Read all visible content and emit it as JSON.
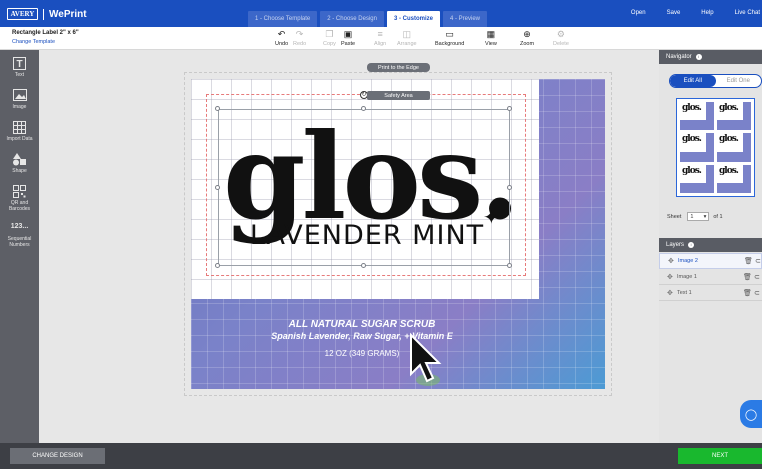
{
  "app": {
    "brand": "AVERY",
    "product": "WePrint"
  },
  "steps": [
    {
      "label": "1 - Choose Template"
    },
    {
      "label": "2 - Choose Design"
    },
    {
      "label": "3 - Customize"
    },
    {
      "label": "4 - Preview"
    }
  ],
  "top_links": [
    "Open",
    "Save",
    "Help",
    "Live Chat"
  ],
  "template": {
    "name": "Rectangle Label 2\" x 6\"",
    "change_link": "Change Template"
  },
  "toolbar": {
    "undo": "Undo",
    "redo": "Redo",
    "copy": "Copy",
    "paste": "Paste",
    "align": "Align",
    "arrange": "Arrange",
    "background": "Background",
    "view": "View",
    "zoom": "Zoom",
    "delete": "Delete"
  },
  "rail": {
    "text": "Text",
    "image": "Image",
    "import_data": "Import Data",
    "shape": "Shape",
    "qr": "QR and Barcodes",
    "seq_num_icon": "123...",
    "seq": "Sequential Numbers"
  },
  "canvas": {
    "print_edge": "Print to the Edge",
    "safety_area": "Safety Area",
    "logo_text": "glos.",
    "subtitle": "LAVENDER MINT",
    "product_line1": "ALL NATURAL SUGAR SCRUB",
    "product_line2": "Spanish Lavender, Raw Sugar, + Vitamin E",
    "product_line3": "12 OZ (349 GRAMS)"
  },
  "navigator": {
    "title": "Navigator",
    "edit_all": "Edit All",
    "edit_one": "Edit One",
    "thumb_text": "glos.",
    "sheet_label": "Sheet",
    "sheet_value": "1",
    "sheet_of": "of 1"
  },
  "layers": {
    "title": "Layers",
    "items": [
      {
        "label": "Image 2"
      },
      {
        "label": "Image 1"
      },
      {
        "label": "Text 1"
      }
    ]
  },
  "bottom": {
    "change_design": "CHANGE DESIGN",
    "next": "NEXT"
  },
  "colors": {
    "primary": "#1a4fbf",
    "next": "#19b82e",
    "label_bg": "#7a82c9"
  }
}
